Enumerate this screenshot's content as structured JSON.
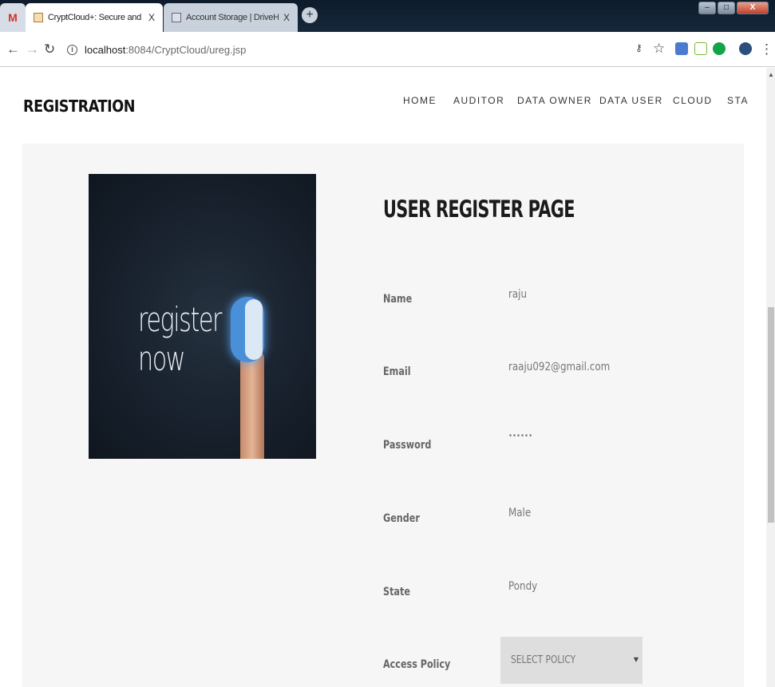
{
  "browser": {
    "tabs": [
      {
        "title": "M"
      },
      {
        "title": "CryptCloud+: Secure and Expres",
        "close": "X"
      },
      {
        "title": "Account Storage | DriveHQ",
        "close": "X"
      }
    ],
    "new_tab": "+",
    "url_host": "localhost",
    "url_rest": ":8084/CryptCloud/ureg.jsp",
    "window_buttons": {
      "minimize": "–",
      "maximize": "□",
      "close": "X"
    }
  },
  "site": {
    "brand": "REGISTRATION",
    "menu": [
      "HOME",
      "AUDITOR",
      "DATA OWNER",
      "DATA USER",
      "CLOUD",
      "STA"
    ]
  },
  "hero_image": {
    "text": "register now"
  },
  "form": {
    "title": "USER REGISTER PAGE",
    "fields": [
      {
        "label": "Name",
        "value": "raju"
      },
      {
        "label": "Email",
        "value": "raaju092@gmail.com"
      },
      {
        "label": "Password",
        "value": "••••••"
      },
      {
        "label": "Gender",
        "value": "Male"
      },
      {
        "label": "State",
        "value": "Pondy"
      },
      {
        "label": "Access Policy",
        "value": "SELECT POLICY"
      }
    ]
  }
}
